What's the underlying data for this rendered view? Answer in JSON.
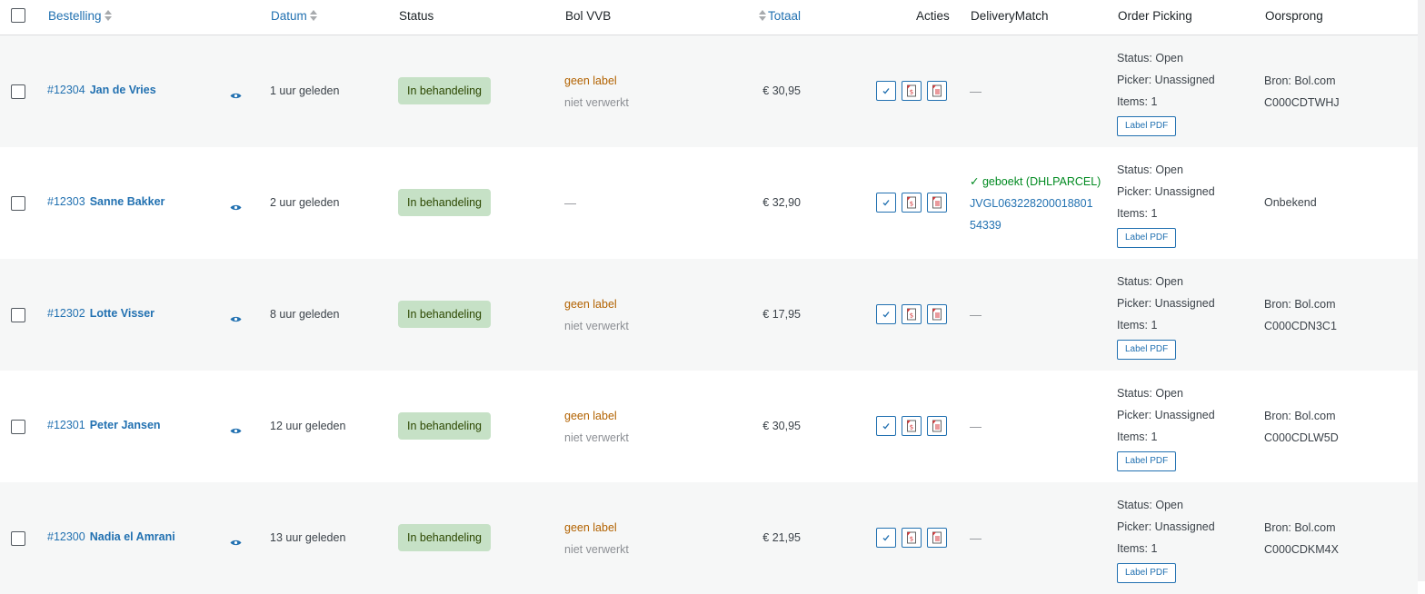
{
  "headers": {
    "order": "Bestelling",
    "date": "Datum",
    "status": "Status",
    "bol": "Bol VVB",
    "total": "Totaal",
    "actions": "Acties",
    "deliverymatch": "DeliveryMatch",
    "picking": "Order Picking",
    "origin": "Oorsprong"
  },
  "icons": {
    "view": "eye-icon",
    "complete": "checkmark-icon",
    "invoice": "pdf-invoice-icon",
    "packing_slip": "pdf-packing-slip-icon"
  },
  "colors": {
    "link": "#2271b1",
    "status_bg": "#c6e1c6",
    "status_text": "#2c4700",
    "bol_label": "#b26200",
    "booked": "#008a20"
  },
  "rows": [
    {
      "number": "#12304",
      "customer": "Jan de Vries",
      "date": "1 uur geleden",
      "status": "In behandeling",
      "bol_label": "geen label",
      "bol_sub": "niet verwerkt",
      "bol_dash": "",
      "total": "€ 30,95",
      "dm_dash": "—",
      "dm_booked": "",
      "dm_tracking": "",
      "pick_status": "Status: Open",
      "pick_picker": "Picker: Unassigned",
      "pick_items": "Items: 1",
      "label_btn": "Label PDF",
      "origin_line1": "Bron: Bol.com",
      "origin_line2": "C000CDTWHJ"
    },
    {
      "number": "#12303",
      "customer": "Sanne Bakker",
      "date": "2 uur geleden",
      "status": "In behandeling",
      "bol_label": "",
      "bol_sub": "",
      "bol_dash": "—",
      "total": "€ 32,90",
      "dm_dash": "",
      "dm_booked": "✓ geboekt (DHLPARCEL)",
      "dm_tracking": "JVGL06322820001880154339",
      "pick_status": "Status: Open",
      "pick_picker": "Picker: Unassigned",
      "pick_items": "Items: 1",
      "label_btn": "Label PDF",
      "origin_line1": "Onbekend",
      "origin_line2": ""
    },
    {
      "number": "#12302",
      "customer": "Lotte Visser",
      "date": "8 uur geleden",
      "status": "In behandeling",
      "bol_label": "geen label",
      "bol_sub": "niet verwerkt",
      "bol_dash": "",
      "total": "€ 17,95",
      "dm_dash": "—",
      "dm_booked": "",
      "dm_tracking": "",
      "pick_status": "Status: Open",
      "pick_picker": "Picker: Unassigned",
      "pick_items": "Items: 1",
      "label_btn": "Label PDF",
      "origin_line1": "Bron: Bol.com",
      "origin_line2": "C000CDN3C1"
    },
    {
      "number": "#12301",
      "customer": "Peter Jansen",
      "date": "12 uur geleden",
      "status": "In behandeling",
      "bol_label": "geen label",
      "bol_sub": "niet verwerkt",
      "bol_dash": "",
      "total": "€ 30,95",
      "dm_dash": "—",
      "dm_booked": "",
      "dm_tracking": "",
      "pick_status": "Status: Open",
      "pick_picker": "Picker: Unassigned",
      "pick_items": "Items: 1",
      "label_btn": "Label PDF",
      "origin_line1": "Bron: Bol.com",
      "origin_line2": "C000CDLW5D"
    },
    {
      "number": "#12300",
      "customer": "Nadia el Amrani",
      "date": "13 uur geleden",
      "status": "In behandeling",
      "bol_label": "geen label",
      "bol_sub": "niet verwerkt",
      "bol_dash": "",
      "total": "€ 21,95",
      "dm_dash": "—",
      "dm_booked": "",
      "dm_tracking": "",
      "pick_status": "Status: Open",
      "pick_picker": "Picker: Unassigned",
      "pick_items": "Items: 1",
      "label_btn": "Label PDF",
      "origin_line1": "Bron: Bol.com",
      "origin_line2": "C000CDKM4X"
    }
  ]
}
